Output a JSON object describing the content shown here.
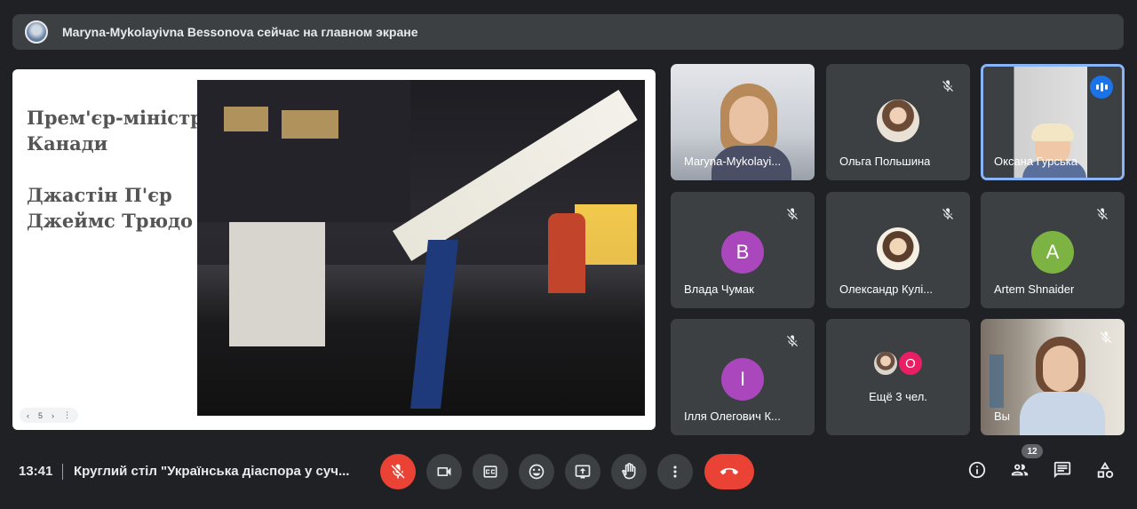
{
  "banner": {
    "text": "Maryna-Mykolayivna Bessonova сейчас на главном экране",
    "avatar_icon": "user-avatar"
  },
  "presentation": {
    "slide_lines": [
      "Прем'єр-міністр",
      "Канади",
      "Джастін П'єр",
      "Джеймс Трюдо"
    ],
    "page_number": "5"
  },
  "participants": [
    {
      "name": "Maryna-Mykolayi...",
      "muted": false,
      "kind": "video"
    },
    {
      "name": "Ольга Польшина",
      "muted": true,
      "kind": "photo"
    },
    {
      "name": "Оксана Гурська",
      "muted": false,
      "speaking": true,
      "kind": "video"
    },
    {
      "name": "Влада Чумак",
      "muted": true,
      "kind": "letter",
      "letter": "В",
      "color": "#ab47bc"
    },
    {
      "name": "Олександр Кулі...",
      "muted": true,
      "kind": "photo"
    },
    {
      "name": "Artem Shnaider",
      "muted": true,
      "kind": "letter",
      "letter": "A",
      "color": "#7cb342"
    },
    {
      "name": "Ілля Олегович К...",
      "muted": true,
      "kind": "letter",
      "letter": "І",
      "color": "#ab47bc"
    },
    {
      "name": "Ещё 3 чел.",
      "kind": "group",
      "letter": "О",
      "color": "#e91e63"
    },
    {
      "name": "Вы",
      "muted": true,
      "kind": "video"
    }
  ],
  "bottom": {
    "time": "13:41",
    "meeting_title": "Круглий стіл \"Українська діаспора у суч...",
    "people_count": "12"
  },
  "colors": {
    "background": "#202124",
    "tile": "#3c4043",
    "accent": "#8ab4f8",
    "danger": "#ea4335"
  }
}
